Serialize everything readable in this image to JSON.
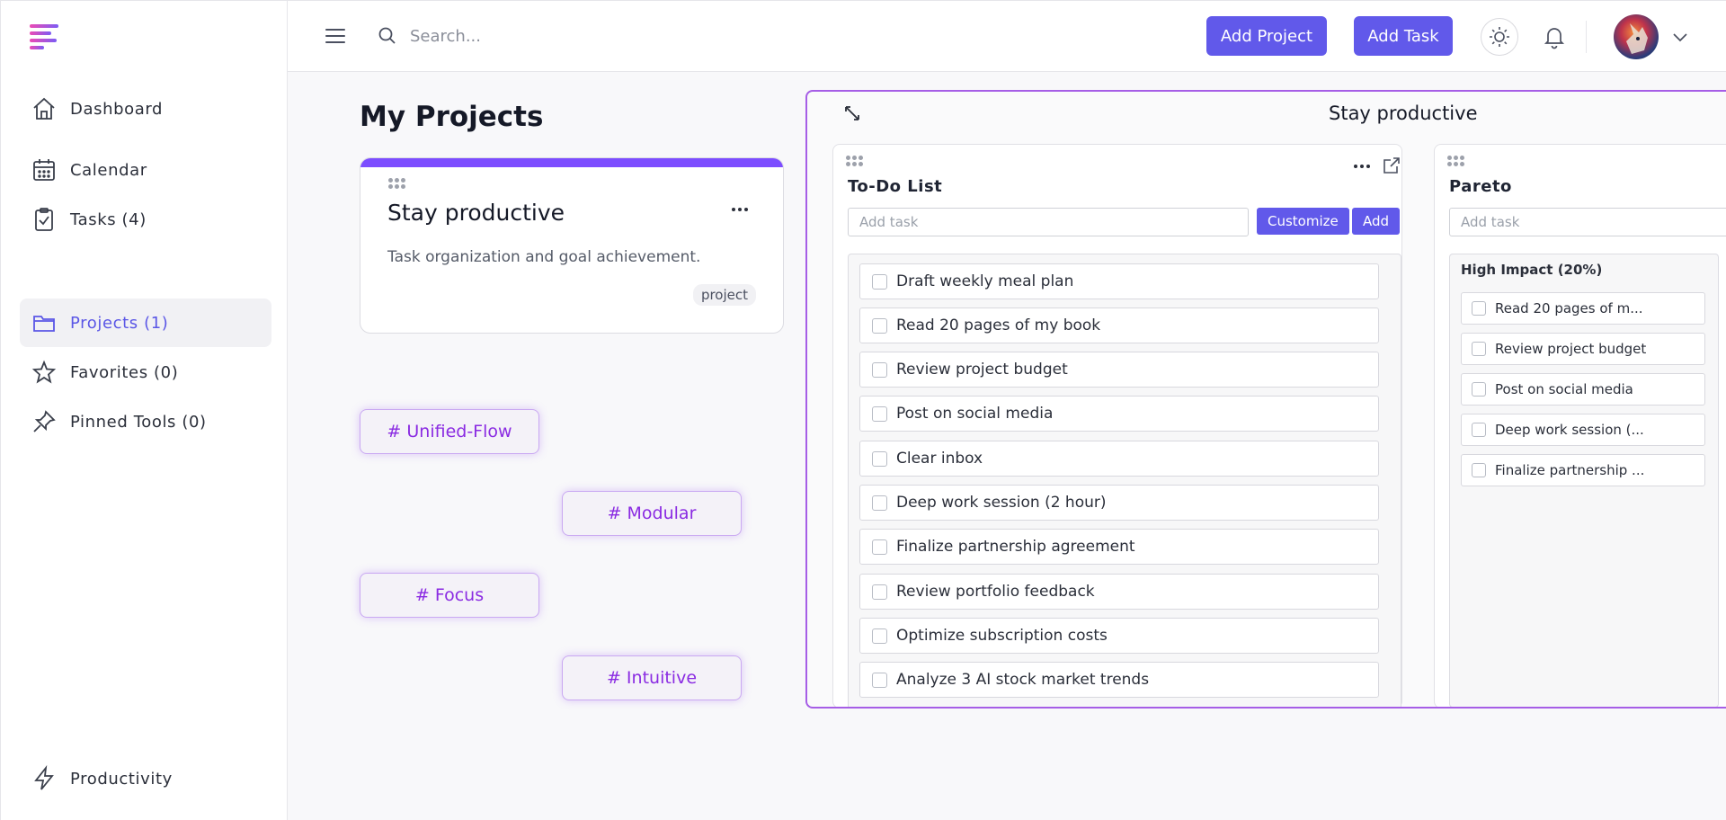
{
  "sidebar": {
    "items": [
      {
        "label": "Dashboard"
      },
      {
        "label": "Calendar"
      },
      {
        "label": "Tasks (4)"
      },
      {
        "label": "Projects (1)"
      },
      {
        "label": "Favorites (0)"
      },
      {
        "label": "Pinned Tools (0)"
      },
      {
        "label": "Productivity"
      }
    ]
  },
  "header": {
    "search_placeholder": "Search...",
    "add_project": "Add Project",
    "add_task": "Add Task"
  },
  "main": {
    "title": "My Projects",
    "project": {
      "title": "Stay productive",
      "description": "Task organization and goal achievement.",
      "tag": "project"
    },
    "chips": [
      "# Unified-Flow",
      "# Modular",
      "# Focus",
      "# Intuitive"
    ]
  },
  "workspace": {
    "title": "Stay productive",
    "todo": {
      "title": "To-Do List",
      "input_placeholder": "Add task",
      "customize": "Customize",
      "add": "Add",
      "tasks": [
        "Draft weekly meal plan",
        "Read 20 pages of my book",
        "Review project budget",
        "Post on social media",
        "Clear inbox",
        "Deep work session (2 hour)",
        "Finalize partnership agreement",
        "Review portfolio feedback",
        "Optimize subscription costs",
        "Analyze 3 AI stock market trends"
      ]
    },
    "pareto": {
      "title": "Pareto",
      "input_placeholder": "Add task",
      "group": "High Impact (20%)",
      "tasks": [
        "Read 20 pages of m...",
        "Review project budget",
        "Post on social media",
        "Deep work session (...",
        "Finalize partnership ..."
      ]
    }
  },
  "colors": {
    "accent": "#6159ea",
    "project_bar": "#7c4dff",
    "chip_text": "#8a2be2",
    "workspace_border": "#a65ee6"
  }
}
